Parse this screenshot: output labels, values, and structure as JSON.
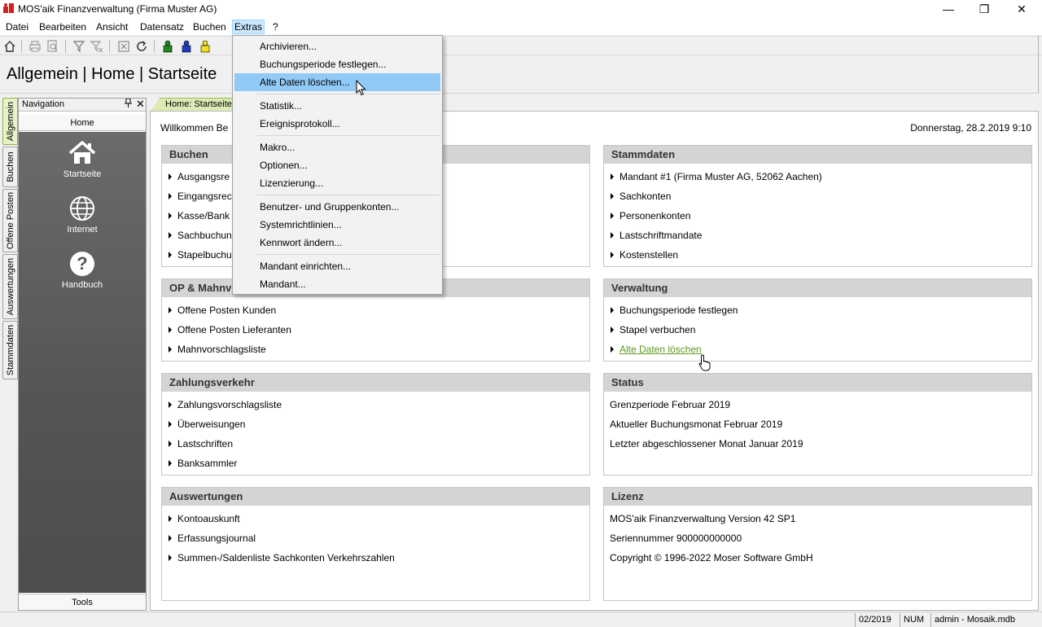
{
  "window": {
    "title": "MOS'aik Finanzverwaltung (Firma Muster AG)",
    "min_glyph": "—",
    "restore_glyph": "❐",
    "close_glyph": "✕"
  },
  "menubar": {
    "items": [
      "Datei",
      "Bearbeiten",
      "Ansicht",
      "Datensatz",
      "Buchen",
      "Extras",
      "?"
    ],
    "active": "Extras"
  },
  "header": {
    "title": "Allgemein | Home | Startseite"
  },
  "vtabs": [
    "Allgemein",
    "Buchen",
    "Offene Posten",
    "Auswertungen",
    "Stammdaten"
  ],
  "navigation": {
    "title": "Navigation",
    "home": "Home",
    "items": [
      {
        "label": "Startseite",
        "icon": "house-icon"
      },
      {
        "label": "Internet",
        "icon": "globe-icon"
      },
      {
        "label": "Handbuch",
        "icon": "help-icon"
      }
    ],
    "tools": "Tools"
  },
  "doc_tab": "Home: Startseite",
  "content": {
    "welcome": "Willkommen Be",
    "date": "Donnerstag, 28.2.2019 9:10",
    "buchen": {
      "title": "Buchen",
      "items": [
        "Ausgangsre",
        "Eingangsrec",
        "Kasse/Bank",
        "Sachbuchun",
        "Stapelbuchu"
      ]
    },
    "op": {
      "title": "OP & Mahnv",
      "items": [
        "Offene Posten Kunden",
        "Offene Posten Lieferanten",
        "Mahnvorschlagsliste"
      ]
    },
    "zahlung": {
      "title": "Zahlungsverkehr",
      "items": [
        "Zahlungsvorschlagsliste",
        "Überweisungen",
        "Lastschriften",
        "Banksammler"
      ]
    },
    "auswertungen": {
      "title": "Auswertungen",
      "items": [
        "Kontoauskunft",
        "Erfassungsjournal",
        "Summen-/Saldenliste Sachkonten Verkehrszahlen"
      ]
    },
    "stammdaten": {
      "title": "Stammdaten",
      "items": [
        "Mandant #1 (Firma Muster AG, 52062 Aachen)",
        "Sachkonten",
        "Personenkonten",
        "Lastschriftmandate",
        "Kostenstellen"
      ]
    },
    "verwaltung": {
      "title": "Verwaltung",
      "items": [
        "Buchungsperiode festlegen",
        "Stapel verbuchen",
        "Alte Daten löschen"
      ]
    },
    "status": {
      "title": "Status",
      "items": [
        "Grenzperiode Februar 2019",
        "Aktueller Buchungsmonat Februar 2019",
        "Letzter abgeschlossener Monat Januar 2019"
      ]
    },
    "lizenz": {
      "title": "Lizenz",
      "items": [
        "MOS'aik Finanzverwaltung Version 42 SP1",
        "Seriennummer 900000000000",
        "Copyright © 1996-2022 Moser Software GmbH"
      ]
    }
  },
  "extras_menu": {
    "items": [
      "Archivieren...",
      "Buchungsperiode festlegen...",
      "Alte Daten löschen...",
      "Statistik...",
      "Ereignisprotokoll...",
      "Makro...",
      "Optionen...",
      "Lizenzierung...",
      "Benutzer- und Gruppenkonten...",
      "Systemrichtlinien...",
      "Kennwort ändern...",
      "Mandant einrichten...",
      "Mandant..."
    ],
    "highlighted": "Alte Daten löschen..."
  },
  "statusbar": {
    "period": "02/2019",
    "num": "NUM",
    "user": "admin - Mosaik.mdb"
  },
  "colors": {
    "accent_green": "#5a9a1c",
    "menu_highlight": "#91c9f7",
    "active_tab": "#e6f2c8"
  }
}
